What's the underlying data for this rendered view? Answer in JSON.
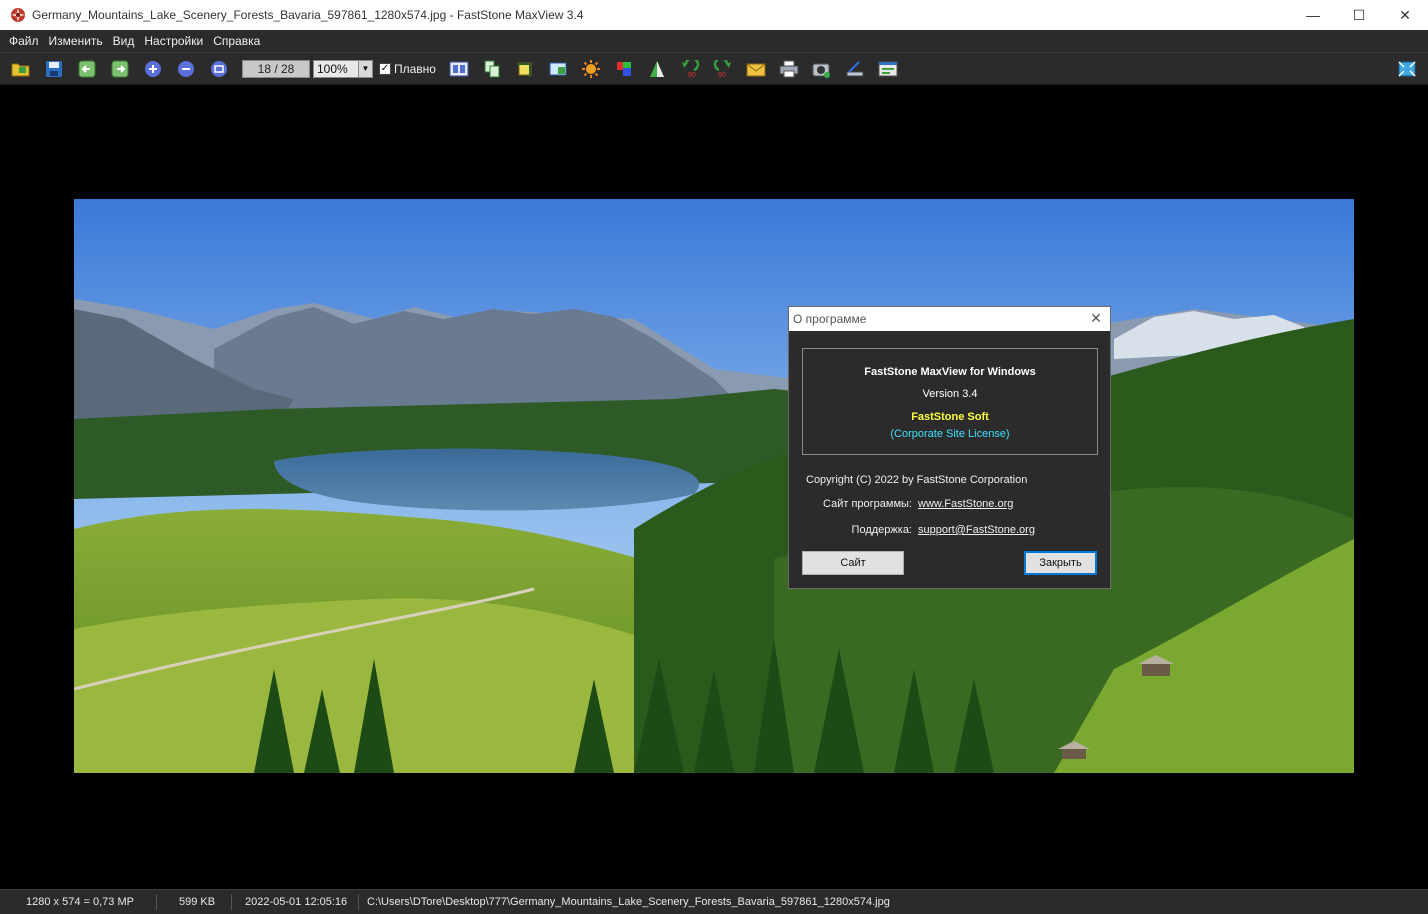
{
  "window": {
    "title": "Germany_Mountains_Lake_Scenery_Forests_Bavaria_597861_1280x574.jpg - FastStone MaxView 3.4",
    "minimize": "—",
    "maximize": "☐",
    "close": "✕"
  },
  "menu": {
    "items": [
      "Файл",
      "Изменить",
      "Вид",
      "Настройки",
      "Справка"
    ]
  },
  "toolbar": {
    "page_counter": "18 / 28",
    "zoom": "100%",
    "smooth_label": "Плавно",
    "smooth_checked": true,
    "icons": [
      "open-folder-icon",
      "save-icon",
      "previous-icon",
      "next-icon",
      "zoom-in-icon",
      "zoom-out-icon",
      "fit-icon",
      "slideshow-icon",
      "copy-icon",
      "crop-icon",
      "resize-icon",
      "adjust-brightness-icon",
      "color-icon",
      "sharpen-icon",
      "rotate-left-icon",
      "rotate-right-icon",
      "email-icon",
      "print-icon",
      "capture-icon",
      "scan-icon",
      "settings-icon",
      "fullscreen-icon"
    ]
  },
  "dialog": {
    "title": "О программе",
    "product": "FastStone MaxView for Windows",
    "version": "Version 3.4",
    "company": "FastStone Soft",
    "license": "(Corporate Site License)",
    "copyright": "Copyright (C) 2022 by FastStone Corporation",
    "site_label": "Сайт программы:",
    "site_link": "www.FastStone.org",
    "support_label": "Поддержка:",
    "support_link": "support@FastStone.org",
    "btn_site": "Сайт",
    "btn_close": "Закрыть",
    "colors": {
      "company": "#ffff40",
      "license": "#40e0ff"
    }
  },
  "status": {
    "dimensions": "1280 x 574 = 0,73 MP",
    "file_size": "599 KB",
    "datetime": "2022-05-01 12:05:16",
    "path": "C:\\Users\\DTore\\Desktop\\777\\Germany_Mountains_Lake_Scenery_Forests_Bavaria_597861_1280x574.jpg"
  }
}
